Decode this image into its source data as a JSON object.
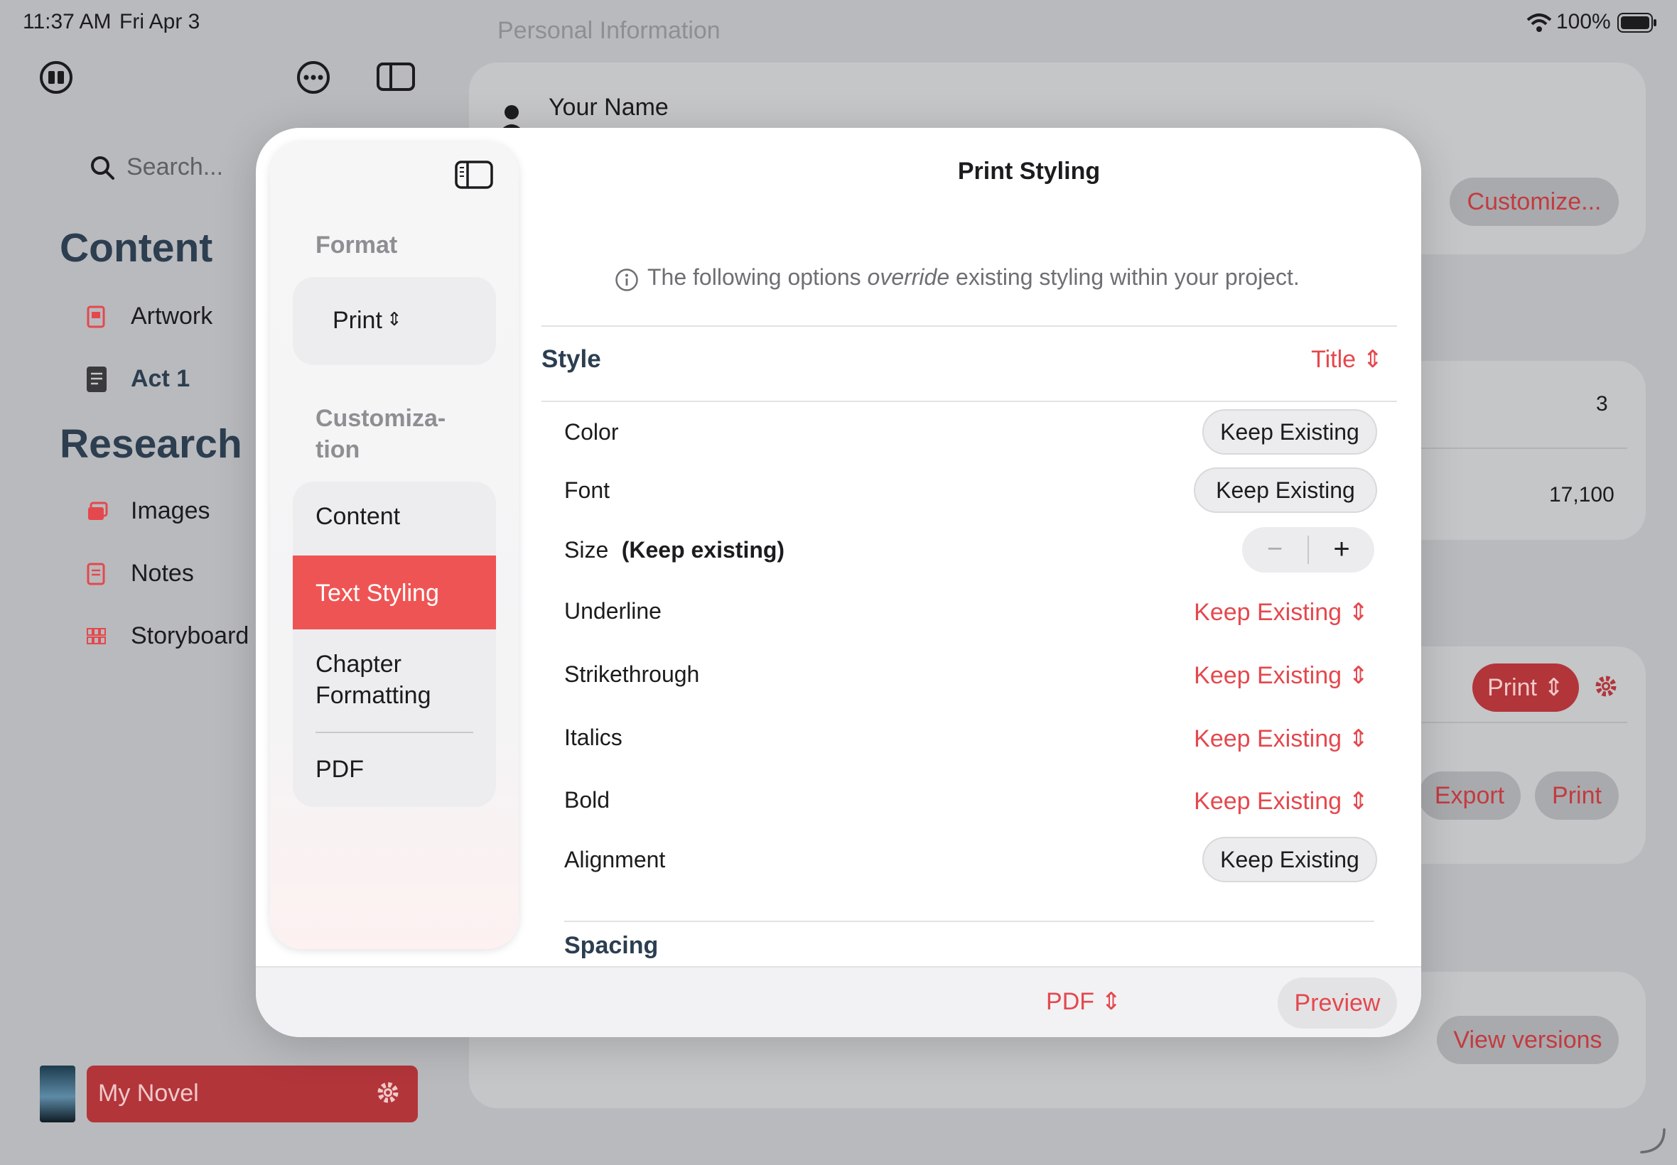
{
  "status_bar": {
    "time": "11:37 AM",
    "date": "Fri Apr 3",
    "battery": "100%"
  },
  "background": {
    "header_title": "Personal Information",
    "your_name": "Your Name",
    "customize_label": "Customize...",
    "stat_1": "3",
    "stat_2": "17,100",
    "print_picker": "Print",
    "export_label": "Export",
    "print_label": "Print",
    "view_versions": "View versions"
  },
  "sidebar": {
    "search_placeholder": "Search...",
    "sections": [
      {
        "title": "Content",
        "items": [
          {
            "label": "Artwork",
            "icon": "document-red-icon"
          },
          {
            "label": "Act 1",
            "icon": "document-dark-icon"
          }
        ]
      },
      {
        "title": "Research",
        "items": [
          {
            "label": "Images",
            "icon": "photos-icon"
          },
          {
            "label": "Notes",
            "icon": "note-icon"
          },
          {
            "label": "Storyboard",
            "icon": "grid-icon"
          }
        ]
      }
    ],
    "project_name": "My Novel"
  },
  "modal": {
    "title": "Print Styling",
    "side": {
      "format_heading": "Format",
      "format_value": "Print",
      "customization_heading_1": "Customiza-",
      "customization_heading_2": "tion",
      "options": [
        "Content",
        "Text Styling",
        "Chapter",
        "Formatting",
        "PDF"
      ],
      "selected": "Text Styling"
    },
    "info": {
      "before": "The following options ",
      "emphasis": "override",
      "after": " existing styling within your project."
    },
    "style_section": {
      "label": "Style",
      "value": "Title"
    },
    "rows": {
      "color": {
        "label": "Color",
        "value": "Keep Existing"
      },
      "font": {
        "label": "Font",
        "value": "Keep Existing"
      },
      "size": {
        "label": "Size",
        "value": "(Keep existing)",
        "minus": "−",
        "plus": "+"
      },
      "underline": {
        "label": "Underline",
        "value": "Keep Existing"
      },
      "strikethrough": {
        "label": "Strikethrough",
        "value": "Keep Existing"
      },
      "italics": {
        "label": "Italics",
        "value": "Keep Existing"
      },
      "bold": {
        "label": "Bold",
        "value": "Keep Existing"
      },
      "alignment": {
        "label": "Alignment",
        "value": "Keep Existing"
      }
    },
    "spacing_section": "Spacing",
    "footer": {
      "format_picker": "PDF",
      "preview_label": "Preview"
    }
  },
  "colors": {
    "accent": "#e4484d",
    "selected_row": "#ef5454",
    "project_bar": "#b2353a",
    "section_heading": "#2c3e50"
  }
}
